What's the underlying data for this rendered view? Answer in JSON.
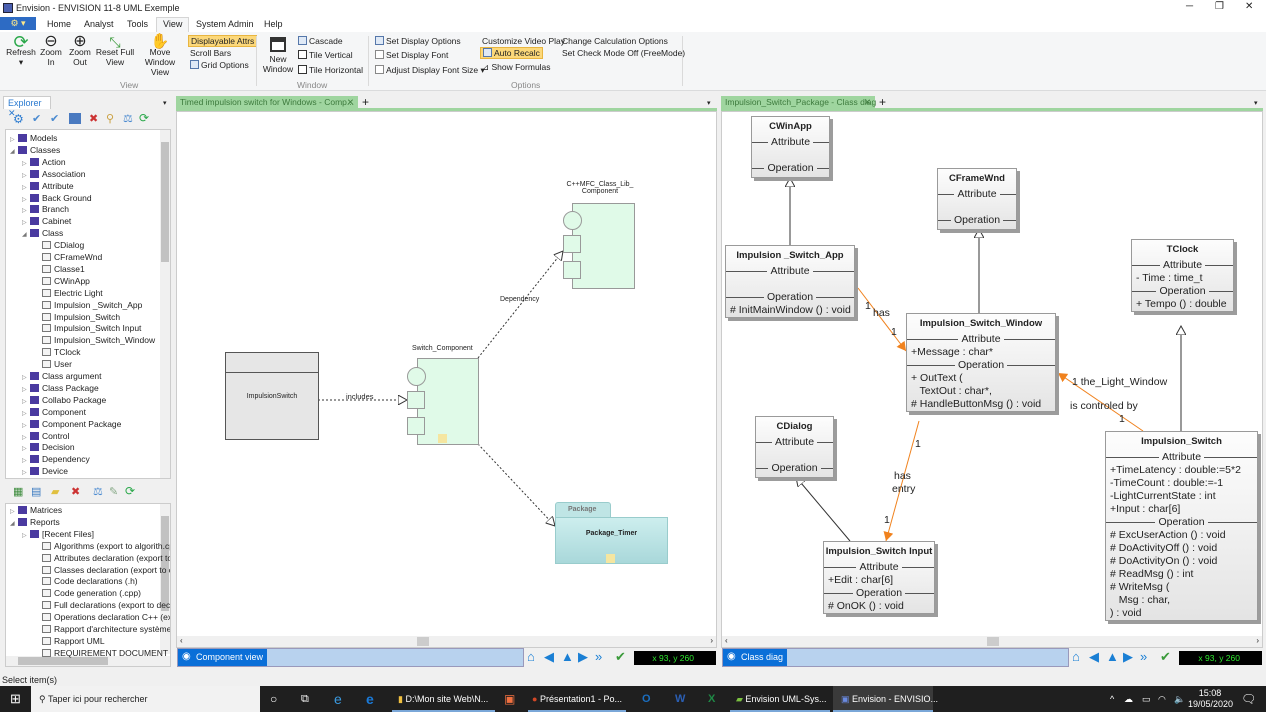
{
  "window": {
    "title": "Envision - ENVISION 11-8 UML Exemple",
    "min": "─",
    "max": "❐",
    "close": "✕"
  },
  "menu": {
    "file": "⚙ ▾",
    "tabs": [
      "Home",
      "Analyst",
      "Tools",
      "View",
      "System Admin",
      "Help"
    ],
    "selected": "View"
  },
  "ribbon": {
    "view_group": {
      "label": "View",
      "refresh": "Refresh",
      "zoom_in": "Zoom In",
      "zoom_out": "Zoom Out",
      "reset": "Reset Full View",
      "move": "Move Window View",
      "displayable": "Displayable Attrs",
      "scroll": "Scroll Bars",
      "grid": "Grid Options"
    },
    "window_group": {
      "label": "Window",
      "new_window": "New Window",
      "cascade": "Cascade",
      "tile_v": "Tile Vertical",
      "tile_h": "Tile Horizontal"
    },
    "options_group": {
      "label": "Options",
      "display_options": "Set Display Options",
      "display_font": "Set Display Font",
      "font_size": "Adjust Display Font Size ▾",
      "video": "Customize Video Play",
      "auto_recalc": "Auto Recalc",
      "formulas": "Show Formulas",
      "calc": "Change Calculation Options",
      "check": "Set Check Mode Off (FreeMode)"
    }
  },
  "explorer": {
    "tab": "Explorer",
    "close": "✕",
    "tree": [
      {
        "l": 0,
        "t": "Models",
        "e": "c"
      },
      {
        "l": 0,
        "t": "Classes",
        "e": "o"
      },
      {
        "l": 1,
        "t": "Action",
        "e": "c"
      },
      {
        "l": 1,
        "t": "Association",
        "e": "c"
      },
      {
        "l": 1,
        "t": "Attribute",
        "e": "c"
      },
      {
        "l": 1,
        "t": "Back Ground",
        "e": "c"
      },
      {
        "l": 1,
        "t": "Branch",
        "e": "c"
      },
      {
        "l": 1,
        "t": "Cabinet",
        "e": "c"
      },
      {
        "l": 1,
        "t": "Class",
        "e": "o"
      },
      {
        "l": 2,
        "t": "CDialog"
      },
      {
        "l": 2,
        "t": "CFrameWnd"
      },
      {
        "l": 2,
        "t": "Classe1"
      },
      {
        "l": 2,
        "t": "CWinApp"
      },
      {
        "l": 2,
        "t": "Electric Light"
      },
      {
        "l": 2,
        "t": "Impulsion _Switch_App"
      },
      {
        "l": 2,
        "t": "Impulsion_Switch"
      },
      {
        "l": 2,
        "t": "Impulsion_Switch Input"
      },
      {
        "l": 2,
        "t": "Impulsion_Switch_Window"
      },
      {
        "l": 2,
        "t": "TClock"
      },
      {
        "l": 2,
        "t": "User"
      },
      {
        "l": 1,
        "t": "Class argument",
        "e": "c"
      },
      {
        "l": 1,
        "t": "Class Package",
        "e": "c"
      },
      {
        "l": 1,
        "t": "Collabo Package",
        "e": "c"
      },
      {
        "l": 1,
        "t": "Component",
        "e": "c"
      },
      {
        "l": 1,
        "t": "Component Package",
        "e": "c"
      },
      {
        "l": 1,
        "t": "Control",
        "e": "c"
      },
      {
        "l": 1,
        "t": "Decision",
        "e": "c"
      },
      {
        "l": 1,
        "t": "Dependency",
        "e": "c"
      },
      {
        "l": 1,
        "t": "Device",
        "e": "c"
      }
    ],
    "tree2": [
      {
        "l": 0,
        "t": "Matrices",
        "e": "c"
      },
      {
        "l": 0,
        "t": "Reports",
        "e": "o"
      },
      {
        "l": 1,
        "t": "[Recent Files]",
        "e": "c"
      },
      {
        "l": 2,
        "t": "Algorithms (export to algorith.cp"
      },
      {
        "l": 2,
        "t": "Attributes declaration (export to"
      },
      {
        "l": 2,
        "t": "Classes declaration (export to cla"
      },
      {
        "l": 2,
        "t": "Code declarations (.h)"
      },
      {
        "l": 2,
        "t": "Code generation (.cpp)"
      },
      {
        "l": 2,
        "t": "Full declarations (export to decla"
      },
      {
        "l": 2,
        "t": "Operations declaration C++ (exp"
      },
      {
        "l": 2,
        "t": "Rapport d'architecture système"
      },
      {
        "l": 2,
        "t": "Rapport UML"
      },
      {
        "l": 2,
        "t": "REQUIREMENT DOCUMENT"
      }
    ]
  },
  "left_doc": {
    "tab": "Timed impulsion switch for Windows - Comp...",
    "close": "✕",
    "add": "+",
    "impulsion_switch": "ImpulsionSwitch",
    "includes": "includes",
    "switch_component": "Switch_Component",
    "mfc_line1": "C++MFC_Class_Lib_",
    "mfc_line2": "Component",
    "dependency": "Dependency",
    "package_tab": "Package",
    "package_name": "Package_Timer",
    "view_label": "Component view",
    "coords": "x 93, y 260"
  },
  "right_doc": {
    "tab": "Impulsion_Switch_Package - Class diag",
    "close": "✕",
    "add": "+",
    "view_label": "Class diag",
    "coords": "x 93, y 260",
    "attr_label": "Attribute",
    "op_label": "Operation",
    "classes": [
      {
        "name": "CWinApp",
        "attrs": [],
        "ops": []
      },
      {
        "name": "CFrameWnd",
        "attrs": [],
        "ops": []
      },
      {
        "name": "Impulsion _Switch_App",
        "attrs": [],
        "ops": [
          "# InitMainWindow () : void"
        ]
      },
      {
        "name": "TClock",
        "attrs": [
          "- Time : time_t"
        ],
        "ops": [
          "+ Tempo () : double"
        ]
      },
      {
        "name": "Impulsion_Switch_Window",
        "attrs": [
          "+Message : char*"
        ],
        "ops": [
          "+ OutText (",
          "   TextOut : char*,",
          "# HandleButtonMsg () : void"
        ]
      },
      {
        "name": "CDialog",
        "attrs": [],
        "ops": []
      },
      {
        "name": "Impulsion_Switch",
        "attrs": [
          "+TimeLatency : double:=5*2",
          "-TimeCount : double:=-1",
          "-LightCurrentState : int",
          "+Input : char[6]"
        ],
        "ops": [
          "# ExcUserAction () : void",
          "# DoActivityOff () : void",
          "# DoActivityOn () : void",
          "# ReadMsg () : int",
          "# WriteMsg (",
          "   Msg : char,",
          ") : void"
        ]
      },
      {
        "name": "Impulsion_Switch Input",
        "attrs": [
          "+Edit : char[6]"
        ],
        "ops": [
          "# OnOK () : void"
        ]
      }
    ],
    "assoc_labels": {
      "has_m1": "1",
      "has": "has",
      "has_m2": "1",
      "light_m1": "1 the_Light_Window",
      "controled": "is controled by",
      "light_m2": "1",
      "entry_m1": "1",
      "entry_has": "has",
      "entry": "entry",
      "entry_m2": "1"
    }
  },
  "status": {
    "text": "Select item(s)"
  },
  "taskbar": {
    "search": "Taper ici pour rechercher",
    "apps": [
      "D:\\Mon site Web\\N...",
      "Présentation1 - Po...",
      "Envision UML-Sys...",
      "Envision - ENVISIO..."
    ],
    "time": "15:08",
    "date": "19/05/2020"
  },
  "colors": {
    "accent": "#0a6fd8",
    "tab_green": "#9fd59f",
    "component_fill": "#e0fae8",
    "package_fill": "#bfe5e5",
    "assoc": "#f0821e"
  }
}
